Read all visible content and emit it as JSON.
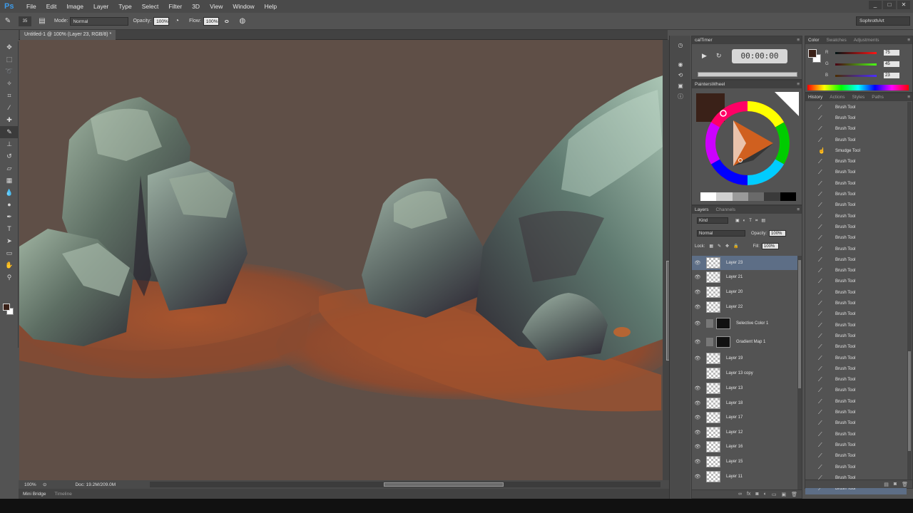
{
  "app": {
    "logo": "Ps",
    "workspace": "SophrothArt"
  },
  "menu": [
    "File",
    "Edit",
    "Image",
    "Layer",
    "Type",
    "Select",
    "Filter",
    "3D",
    "View",
    "Window",
    "Help"
  ],
  "window_controls": [
    "_",
    "□",
    "✕"
  ],
  "options": {
    "mode_label": "Mode:",
    "mode_value": "Normal",
    "opacity_label": "Opacity:",
    "opacity_value": "100%",
    "flow_label": "Flow:",
    "flow_value": "100%",
    "brush_size": "35"
  },
  "document": {
    "tab_title": "Untitled-1 @ 100% (Layer 23, RGB/8) *"
  },
  "status": {
    "zoom": "100%",
    "doc_info": "Doc: 19.2M/209.0M"
  },
  "bottom_tabs": [
    {
      "label": "Mini Bridge"
    },
    {
      "label": "Timeline"
    }
  ],
  "caltimer": {
    "title": "calTimer",
    "time": "00:00:00"
  },
  "painterswheel": {
    "title": "PaintersWheel",
    "grays": [
      "#ffffff",
      "#d0d0d0",
      "#9a9a9a",
      "#6a6a6a",
      "#3a3a3a",
      "#000000"
    ]
  },
  "layers_panel": {
    "tabs": [
      "Layers",
      "Channels"
    ],
    "filter": "Kind",
    "blend_mode": "Normal",
    "opacity_label": "Opacity:",
    "opacity_value": "100%",
    "lock_label": "Lock:",
    "fill_label": "Fill:",
    "fill_value": "100%",
    "layers": [
      {
        "name": "Layer 23",
        "selected": true,
        "type": "pixel"
      },
      {
        "name": "Layer 21",
        "type": "pixel"
      },
      {
        "name": "Layer 20",
        "type": "pixel"
      },
      {
        "name": "Layer 22",
        "type": "pixel"
      },
      {
        "name": "Selective Color 1",
        "type": "adjustment"
      },
      {
        "name": "Gradient Map 1",
        "type": "adjustment"
      },
      {
        "name": "Layer 19",
        "type": "pixel"
      },
      {
        "name": "Layer 13 copy",
        "type": "pixel",
        "hidden": true
      },
      {
        "name": "Layer 13",
        "type": "pixel"
      },
      {
        "name": "Layer 18",
        "type": "pixel"
      },
      {
        "name": "Layer 17",
        "type": "pixel"
      },
      {
        "name": "Layer 12",
        "type": "pixel"
      },
      {
        "name": "Layer 16",
        "type": "pixel"
      },
      {
        "name": "Layer 15",
        "type": "pixel"
      },
      {
        "name": "Layer 11",
        "type": "pixel"
      }
    ]
  },
  "color_panel": {
    "tabs": [
      "Color",
      "Swatches",
      "Adjustments"
    ],
    "fg": "#3a2118",
    "channels": [
      {
        "label": "R",
        "value": "75",
        "gradient": "linear-gradient(90deg,#001515,#ff1515)"
      },
      {
        "label": "G",
        "value": "45",
        "gradient": "linear-gradient(90deg,#4b0014,#4bff14)"
      },
      {
        "label": "B",
        "value": "23",
        "gradient": "linear-gradient(90deg,#4b2d00,#4b2dff)"
      }
    ]
  },
  "history_panel": {
    "tabs": [
      "History",
      "Actions",
      "Styles",
      "Paths"
    ],
    "items": [
      "Brush Tool",
      "Brush Tool",
      "Brush Tool",
      "Brush Tool",
      "Smudge Tool",
      "Brush Tool",
      "Brush Tool",
      "Brush Tool",
      "Brush Tool",
      "Brush Tool",
      "Brush Tool",
      "Brush Tool",
      "Brush Tool",
      "Brush Tool",
      "Brush Tool",
      "Brush Tool",
      "Brush Tool",
      "Brush Tool",
      "Brush Tool",
      "Brush Tool",
      "Brush Tool",
      "Brush Tool",
      "Brush Tool",
      "Brush Tool",
      "Brush Tool",
      "Brush Tool",
      "Brush Tool",
      "Brush Tool",
      "Brush Tool",
      "Brush Tool",
      "Brush Tool",
      "Brush Tool",
      "Brush Tool",
      "Brush Tool",
      "Brush Tool",
      "Brush Tool"
    ]
  },
  "tools": [
    "move-icon",
    "marquee-icon",
    "lasso-icon",
    "quick-select-icon",
    "crop-icon",
    "eyedropper-icon",
    "healing-icon",
    "brush-icon",
    "stamp-icon",
    "history-brush-icon",
    "eraser-icon",
    "gradient-icon",
    "blur-icon",
    "dodge-icon",
    "pen-icon",
    "type-icon",
    "path-select-icon",
    "shape-icon",
    "hand-icon",
    "zoom-icon"
  ]
}
